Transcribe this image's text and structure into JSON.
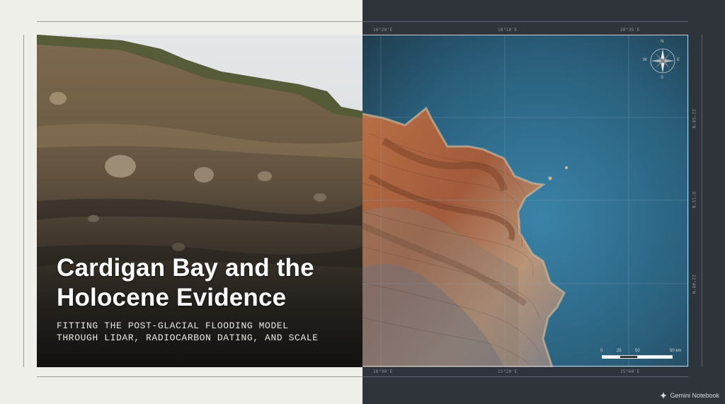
{
  "title": {
    "line1": "Cardigan Bay and the",
    "line2": "Holocene Evidence"
  },
  "subtitle": {
    "line1": "FITTING THE POST-GLACIAL FLOODING MODEL",
    "line2": "THROUGH LIDAR, RADIOCARBON DATING, AND SCALE"
  },
  "map": {
    "top_coords": [
      "10°20'E",
      "10°10'E",
      "20°35'E"
    ],
    "bottom_coords": [
      "10°90'E",
      "15°20'E",
      "25°60'E"
    ],
    "right_coords": [
      "22°50'N",
      "8°15'N",
      "22°40'N"
    ],
    "compass": {
      "n": "N",
      "s": "S",
      "e": "E",
      "w": "W"
    },
    "scale": {
      "labels": [
        "0",
        "25",
        "50",
        "50 km"
      ]
    }
  },
  "brand": {
    "label": "Gemini Notebook",
    "icon": "gemini-sparkle-icon"
  },
  "colors": {
    "sea": "#2b6b8c",
    "panel_dark": "#2f343b",
    "panel_light": "#efefe9"
  }
}
